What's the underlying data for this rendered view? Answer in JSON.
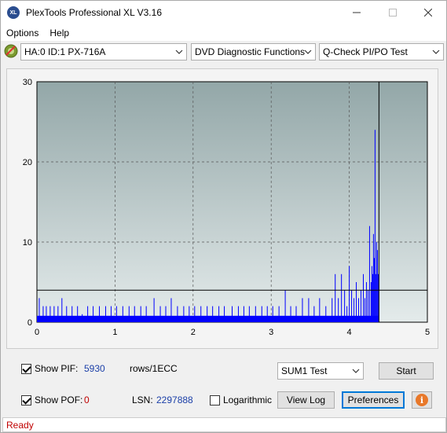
{
  "window": {
    "title": "PlexTools Professional XL V3.16",
    "icon_text": "XL"
  },
  "menu": {
    "options": "Options",
    "help": "Help"
  },
  "toolbar": {
    "drive": "HA:0 ID:1  PX-716A",
    "function": "DVD Diagnostic Functions",
    "test": "Q-Check PI/PO Test"
  },
  "chart_data": {
    "type": "bar",
    "xlim": [
      0,
      5
    ],
    "ylim": [
      0,
      30
    ],
    "x_ticks": [
      "0",
      "1",
      "2",
      "3",
      "4",
      "5"
    ],
    "y_ticks": [
      "0",
      "10",
      "20",
      "30"
    ],
    "threshold": 4,
    "end_marker_x": 4.38,
    "grid": true,
    "series": [
      {
        "color": "#0000ff",
        "points": [
          [
            0.03,
            3
          ],
          [
            0.08,
            2
          ],
          [
            0.12,
            2
          ],
          [
            0.17,
            2
          ],
          [
            0.22,
            2
          ],
          [
            0.27,
            2
          ],
          [
            0.32,
            3
          ],
          [
            0.38,
            2
          ],
          [
            0.45,
            2
          ],
          [
            0.52,
            2
          ],
          [
            0.58,
            1
          ],
          [
            0.65,
            2
          ],
          [
            0.72,
            2
          ],
          [
            0.8,
            2
          ],
          [
            0.88,
            2
          ],
          [
            0.95,
            2
          ],
          [
            1.02,
            2
          ],
          [
            1.1,
            2
          ],
          [
            1.18,
            2
          ],
          [
            1.25,
            2
          ],
          [
            1.33,
            2
          ],
          [
            1.4,
            2
          ],
          [
            1.5,
            3
          ],
          [
            1.58,
            2
          ],
          [
            1.65,
            2
          ],
          [
            1.72,
            3
          ],
          [
            1.8,
            2
          ],
          [
            1.88,
            2
          ],
          [
            1.95,
            2
          ],
          [
            2.02,
            2
          ],
          [
            2.1,
            2
          ],
          [
            2.18,
            2
          ],
          [
            2.25,
            2
          ],
          [
            2.33,
            2
          ],
          [
            2.4,
            2
          ],
          [
            2.5,
            2
          ],
          [
            2.58,
            2
          ],
          [
            2.65,
            2
          ],
          [
            2.72,
            2
          ],
          [
            2.8,
            2
          ],
          [
            2.88,
            2
          ],
          [
            2.95,
            2
          ],
          [
            3.02,
            2
          ],
          [
            3.1,
            2
          ],
          [
            3.18,
            4
          ],
          [
            3.25,
            2
          ],
          [
            3.32,
            2
          ],
          [
            3.4,
            3
          ],
          [
            3.48,
            3
          ],
          [
            3.55,
            2
          ],
          [
            3.62,
            3
          ],
          [
            3.7,
            2
          ],
          [
            3.78,
            3
          ],
          [
            3.82,
            6
          ],
          [
            3.86,
            3
          ],
          [
            3.9,
            6
          ],
          [
            3.94,
            4
          ],
          [
            3.97,
            2
          ],
          [
            4.0,
            7
          ],
          [
            4.03,
            4
          ],
          [
            4.06,
            3
          ],
          [
            4.09,
            5
          ],
          [
            4.12,
            3
          ],
          [
            4.15,
            4
          ],
          [
            4.18,
            6
          ],
          [
            4.2,
            3
          ],
          [
            4.22,
            5
          ],
          [
            4.24,
            4
          ],
          [
            4.26,
            12
          ],
          [
            4.28,
            5
          ],
          [
            4.29,
            7
          ],
          [
            4.3,
            6
          ],
          [
            4.31,
            11
          ],
          [
            4.32,
            8
          ],
          [
            4.33,
            24
          ],
          [
            4.34,
            6
          ],
          [
            4.35,
            10
          ],
          [
            4.36,
            9
          ],
          [
            4.37,
            6
          ]
        ]
      }
    ]
  },
  "controls": {
    "show_pif_label": "Show PIF:",
    "show_pif_value": "5930",
    "pif_unit": "rows/1ECC",
    "show_pof_label": "Show POF:",
    "show_pof_value": "0",
    "lsn_label": "LSN:",
    "lsn_value": "2297888",
    "logarithmic_label": "Logarithmic",
    "test_select": "SUM1 Test",
    "start_label": "Start",
    "view_log_label": "View Log",
    "preferences_label": "Preferences"
  },
  "status": {
    "text": "Ready"
  }
}
